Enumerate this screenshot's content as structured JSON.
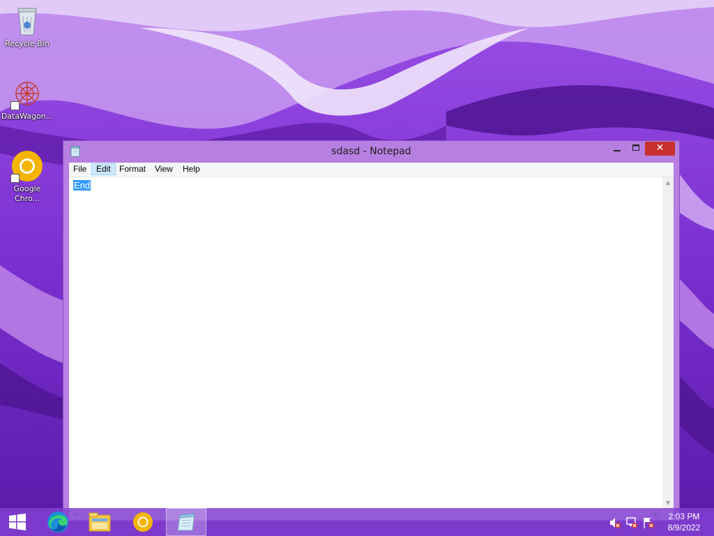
{
  "desktop": {
    "icons": [
      {
        "label": "Recycle Bin",
        "icon": "recycle-bin-icon"
      },
      {
        "label": "DataWagon...",
        "icon": "datawagon-icon"
      },
      {
        "label": "Google\nChro...",
        "icon": "chrome-icon"
      }
    ]
  },
  "notepad": {
    "title": "sdasd - Notepad",
    "menu": [
      "File",
      "Edit",
      "Format",
      "View",
      "Help"
    ],
    "active_menu": "Edit",
    "content": "End",
    "content_selected": true
  },
  "taskbar": {
    "apps": [
      {
        "name": "Start",
        "icon": "windows-start-icon"
      },
      {
        "name": "Microsoft Edge",
        "icon": "edge-icon"
      },
      {
        "name": "File Explorer",
        "icon": "file-explorer-icon"
      },
      {
        "name": "Google Chrome",
        "icon": "chrome-icon"
      },
      {
        "name": "Notepad",
        "icon": "notepad-icon",
        "active": true
      }
    ],
    "tray": [
      "volume-muted-icon",
      "network-error-icon",
      "action-center-flag-icon"
    ],
    "time": "2:03 PM",
    "date": "8/9/2022"
  },
  "colors": {
    "wallpaper_base": "#7a2fd0",
    "window_frame": "#b77fe1",
    "close_button": "#c7302f",
    "selection": "#3399ff",
    "menu_hover": "#cce8ff"
  }
}
